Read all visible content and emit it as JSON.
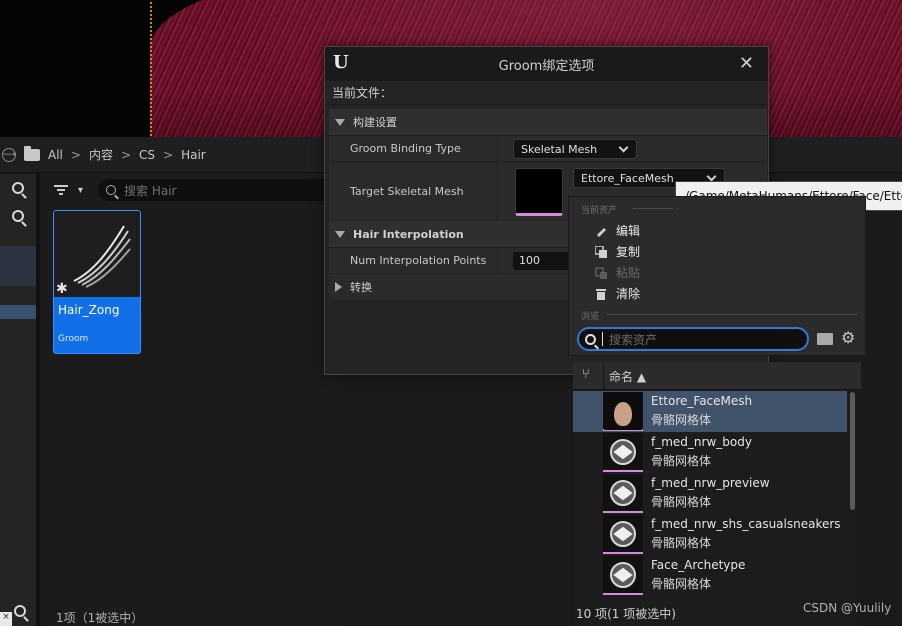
{
  "viewport": {
    "hair_color": "#7a1530"
  },
  "content_browser": {
    "breadcrumb": [
      "All",
      "内容",
      "CS",
      "Hair"
    ],
    "breadcrumb_sep": ">",
    "search_placeholder": "搜索 Hair",
    "asset": {
      "name": "Hair_Zong",
      "type": "Groom"
    },
    "status": "1项（1被选中）"
  },
  "dialog": {
    "title": "Groom绑定选项",
    "current_file_label": "当前文件：",
    "section_build": "构建设置",
    "groom_binding_type_label": "Groom Binding Type",
    "groom_binding_type_value": "Skeletal Mesh",
    "target_skeletal_mesh_label": "Target Skeletal Mesh",
    "target_skeletal_mesh_value": "Ettore_FaceMesh",
    "section_interp": "Hair Interpolation",
    "num_interp_label": "Num Interpolation Points",
    "num_interp_value": "100",
    "section_convert": "转换"
  },
  "tooltip": "/Game/MetaHumans/Ettore/Face/Ettore_FaceMesh",
  "picker": {
    "current_asset_heading": "当前资产",
    "actions": [
      {
        "label": "编辑",
        "icon": "pencil-icon",
        "enabled": true
      },
      {
        "label": "复制",
        "icon": "copy-icon",
        "enabled": true
      },
      {
        "label": "粘贴",
        "icon": "paste-icon",
        "enabled": false
      },
      {
        "label": "清除",
        "icon": "trash-icon",
        "enabled": true
      }
    ],
    "browse_heading": "浏览",
    "search_placeholder": "搜索资产"
  },
  "asset_list": {
    "column_name": "命名 ▲",
    "rows": [
      {
        "name": "Ettore_FaceMesh",
        "type": "骨骼网格体",
        "selected": true,
        "thumb": "face"
      },
      {
        "name": "f_med_nrw_body",
        "type": "骨骼网格体",
        "selected": false,
        "thumb": "mesh"
      },
      {
        "name": "f_med_nrw_preview",
        "type": "骨骼网格体",
        "selected": false,
        "thumb": "mesh"
      },
      {
        "name": "f_med_nrw_shs_casualsneakers",
        "type": "骨骼网格体",
        "selected": false,
        "thumb": "mesh"
      },
      {
        "name": "Face_Archetype",
        "type": "骨骼网格体",
        "selected": false,
        "thumb": "mesh"
      }
    ],
    "status": "10 项(1 项被选中)"
  },
  "watermark": "CSDN @Yuulily"
}
